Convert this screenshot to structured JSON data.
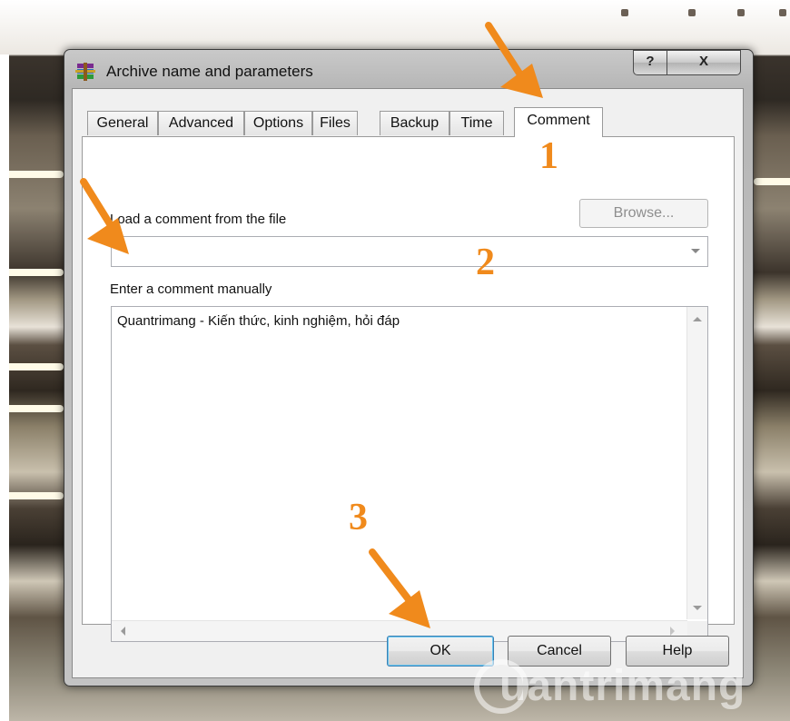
{
  "window": {
    "title": "Archive name and parameters",
    "help_label": "?",
    "close_label": "X"
  },
  "tabs": [
    {
      "label": "General"
    },
    {
      "label": "Advanced"
    },
    {
      "label": "Options"
    },
    {
      "label": "Files"
    },
    {
      "label": "Backup"
    },
    {
      "label": "Time"
    },
    {
      "label": "Comment",
      "selected": true
    }
  ],
  "comment_tab": {
    "load_label": "Load a comment from the file",
    "browse_label": "Browse...",
    "file_value": "",
    "manual_label": "Enter a comment manually",
    "comment_text": "Quantrimang - Kiến thức, kinh nghiệm, hỏi đáp"
  },
  "buttons": {
    "ok": "OK",
    "cancel": "Cancel",
    "help": "Help"
  },
  "annotations": [
    "1",
    "2",
    "3"
  ],
  "watermark": "uantrimang",
  "colors": {
    "annotation": "#f08a1c",
    "window_frame": "#bdbdbd",
    "ok_focus": "#3c7fb1"
  },
  "icons": [
    "winrar-archive-icon",
    "help-icon",
    "close-icon",
    "dropdown-arrow-icon",
    "scroll-arrow-icon"
  ]
}
